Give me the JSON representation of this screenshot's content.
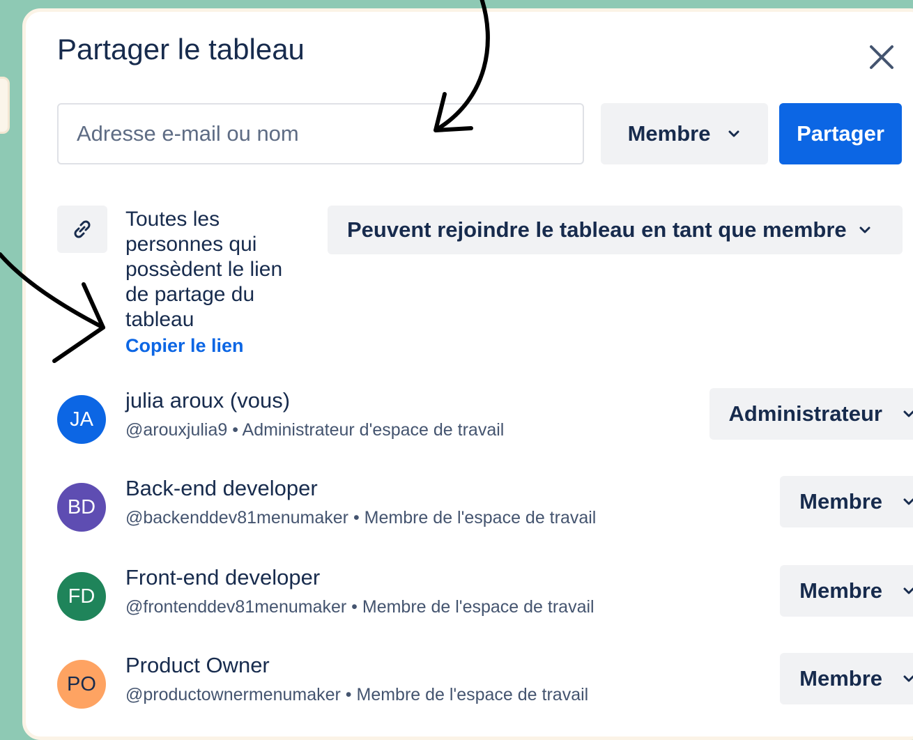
{
  "dialog": {
    "title": "Partager le tableau",
    "close_icon": "close-icon"
  },
  "invite": {
    "placeholder": "Adresse e-mail ou nom",
    "role_label": "Membre",
    "share_label": "Partager"
  },
  "link": {
    "icon": "link-icon",
    "description": "Toutes les personnes qui possèdent le lien de partage du tableau",
    "permission_label": "Peuvent rejoindre le tableau en tant que membre",
    "copy_label": "Copier le lien"
  },
  "members": [
    {
      "initials": "JA",
      "color": "#0c66e4",
      "name": "julia aroux (vous)",
      "subtitle": "@arouxjulia9 • Administrateur d'espace de travail",
      "role": "Administrateur"
    },
    {
      "initials": "BD",
      "color": "#5e4db2",
      "name": "Back-end developer",
      "subtitle": "@backenddev81menumaker • Membre de l'espace de travail",
      "role": "Membre"
    },
    {
      "initials": "FD",
      "color": "#1f845a",
      "name": "Front-end developer",
      "subtitle": "@frontenddev81menumaker • Membre de l'espace de travail",
      "role": "Membre"
    },
    {
      "initials": "PO",
      "color": "#fea362",
      "name": "Product Owner",
      "subtitle": "@productownermenumaker • Membre de l'espace de travail",
      "role": "Membre"
    }
  ],
  "colors": {
    "background": "#8ec9b4",
    "primary": "#0c66e4",
    "button_grey": "#f1f2f4"
  }
}
